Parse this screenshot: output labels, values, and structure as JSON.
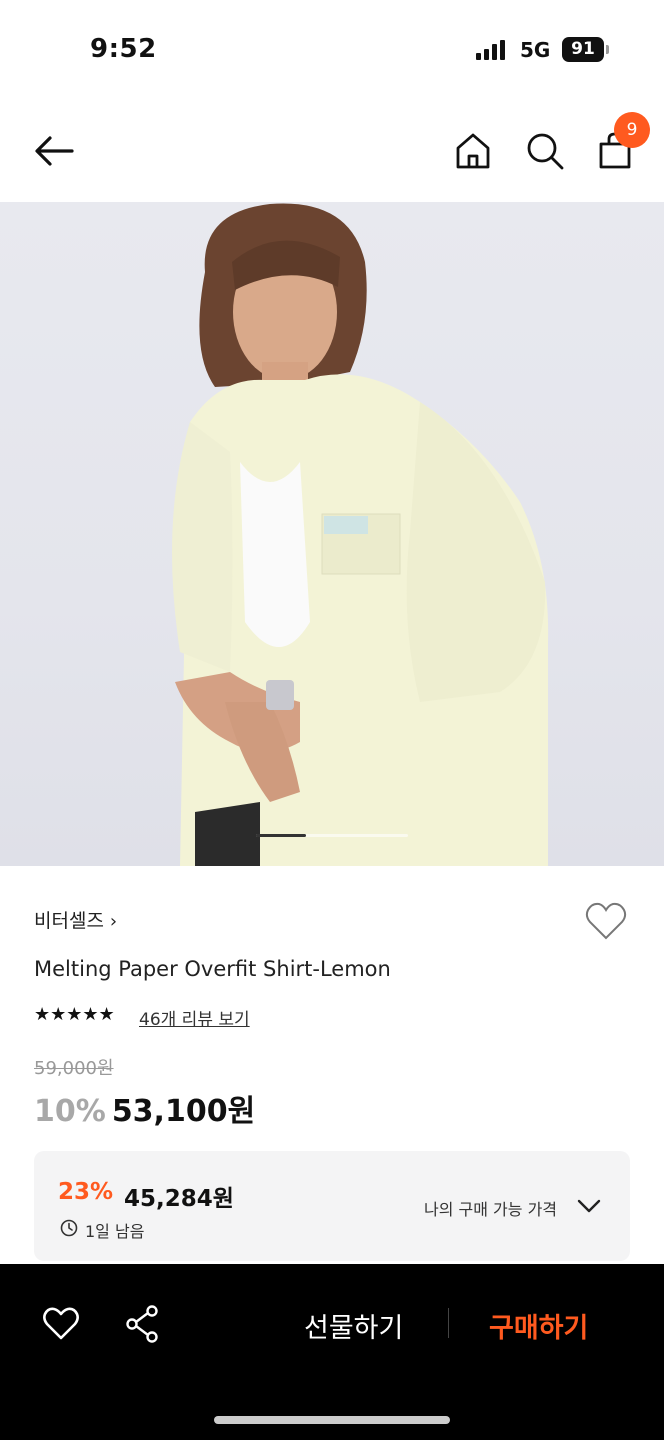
{
  "status_bar": {
    "time": "9:52",
    "network": "5G",
    "battery": "91"
  },
  "nav": {
    "cart_count": "9",
    "icons": [
      "back-arrow-icon",
      "home-icon",
      "search-icon",
      "shopping-bag-icon"
    ]
  },
  "hero": {
    "image_alt": "Model wearing lemon overfit shirt",
    "carousel_index": 1,
    "carousel_total": 3
  },
  "product": {
    "brand": "비터셀즈",
    "brand_chevron": "›",
    "name": "Melting Paper Overfit Shirt-Lemon",
    "stars": "★★★★★",
    "review_link": "46개 리뷰 보기",
    "original_price": "59,000원",
    "discount_percent": "10%",
    "discount_price": "53,100원"
  },
  "my_price": {
    "percent": "23%",
    "price": "45,284원",
    "remaining": "1일 남음",
    "label": "나의 구매 가능 가격"
  },
  "bottom_bar": {
    "gift_label": "선물하기",
    "buy_label": "구매하기"
  },
  "colors": {
    "accent": "#ff5a1f",
    "bar": "#000000"
  }
}
